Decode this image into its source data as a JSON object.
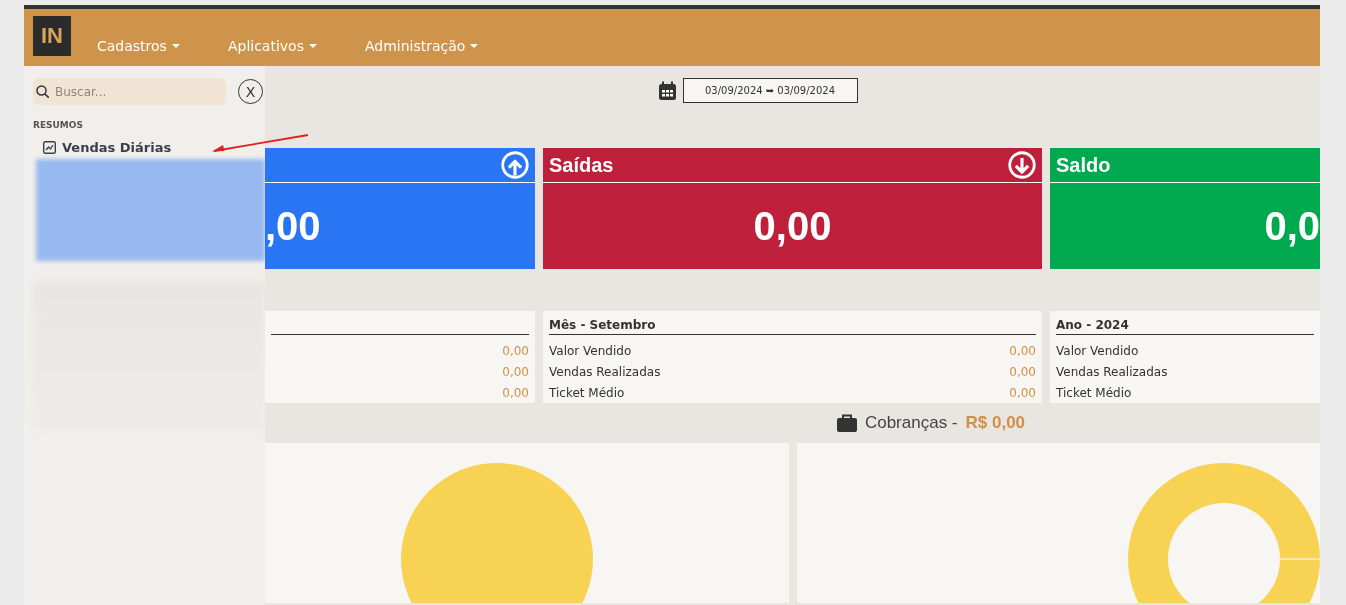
{
  "header": {
    "logo": "IN",
    "menu": [
      {
        "label": "Cadastros"
      },
      {
        "label": "Aplicativos"
      },
      {
        "label": "Administração"
      }
    ]
  },
  "sidebar": {
    "search": {
      "placeholder": "Buscar..."
    },
    "close_label": "X",
    "section": "RESUMOS",
    "items": [
      {
        "label": "Vendas Diárias"
      }
    ]
  },
  "date_range": "03/09/2024 ➥ 03/09/2024",
  "cards": [
    {
      "kind": "in",
      "value": ",00",
      "color": "#2a75f3"
    },
    {
      "kind": "out",
      "title": "Saídas",
      "value": "0,00",
      "color": "#be203b"
    },
    {
      "kind": "none",
      "title": "Saldo",
      "value": "0,0",
      "color": "#00a84f"
    }
  ],
  "tables": [
    {
      "rows": [
        {
          "value": "0,00"
        },
        {
          "value": "0,00"
        },
        {
          "value": "0,00"
        }
      ]
    },
    {
      "title": "Mês - Setembro",
      "rows": [
        {
          "label": "Valor Vendido",
          "value": "0,00"
        },
        {
          "label": "Vendas Realizadas",
          "value": "0,00"
        },
        {
          "label": "Ticket Médio",
          "value": "0,00"
        }
      ]
    },
    {
      "title": "Ano - 2024",
      "rows": [
        {
          "label": "Valor Vendido"
        },
        {
          "label": "Vendas Realizadas"
        },
        {
          "label": "Ticket Médio"
        }
      ]
    }
  ],
  "charges": {
    "title": "Cobranças -",
    "amount": "R$ 0,00"
  }
}
